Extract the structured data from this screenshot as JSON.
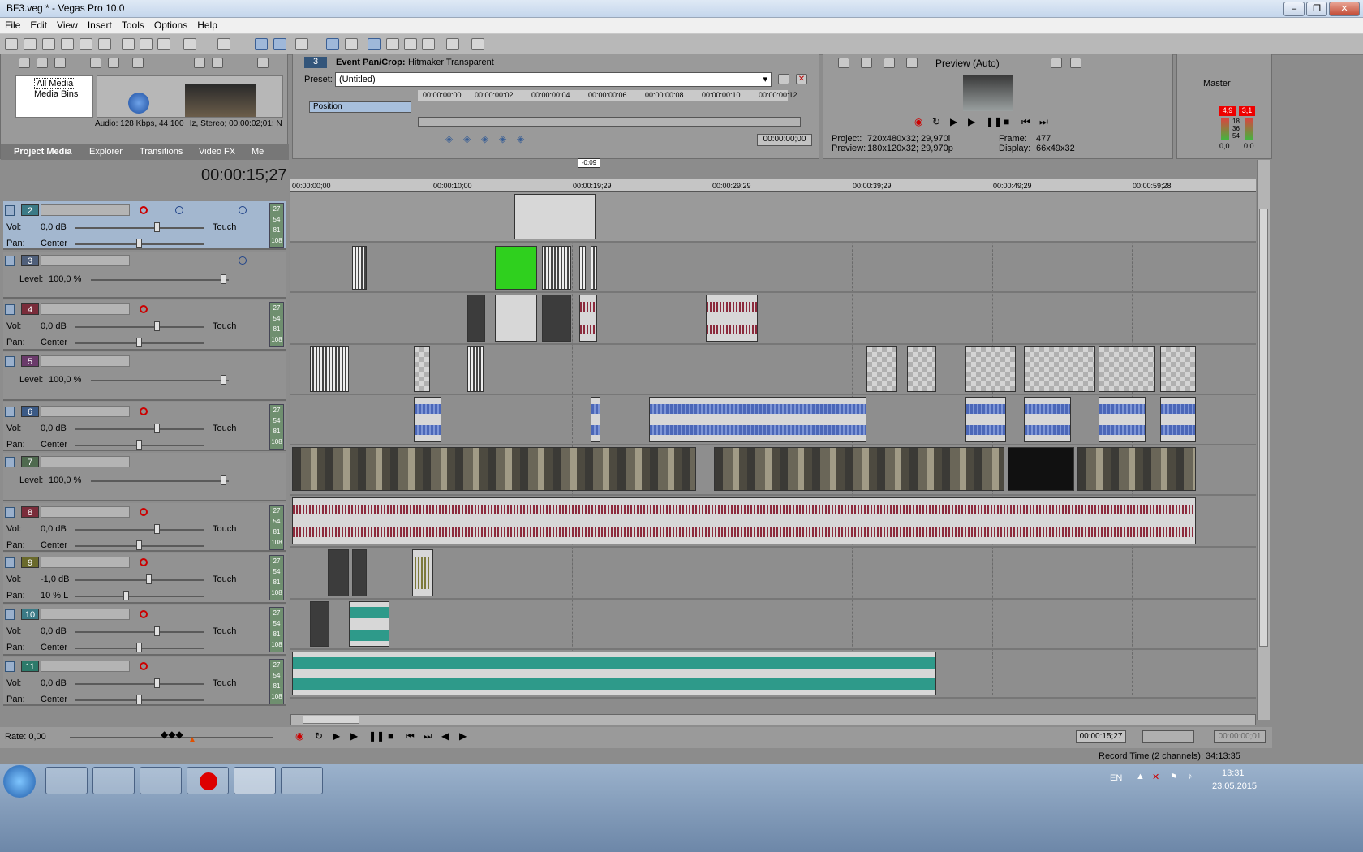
{
  "window": {
    "title": "BF3.veg * - Vegas Pro 10.0",
    "min": "‒",
    "max": "❐",
    "close": "✕"
  },
  "menu": [
    "File",
    "Edit",
    "View",
    "Insert",
    "Tools",
    "Options",
    "Help"
  ],
  "media": {
    "tree_all": "All Media",
    "tree_bins": "Media Bins",
    "audio_info": "Audio: 128 Kbps, 44 100 Hz, Stereo; 00:00:02;01; N",
    "tabs": [
      "Project Media",
      "Explorer",
      "Transitions",
      "Video FX",
      "Me"
    ]
  },
  "panzoom": {
    "track_num": "3",
    "title": "Event Pan/Crop:",
    "title_value": "Hitmaker Transparent",
    "preset_label": "Preset:",
    "preset_value": "(Untitled)",
    "position_label": "Position",
    "ruler": [
      "00:00:00:00",
      "00:00:00:02",
      "00:00:00:04",
      "00:00:00:06",
      "00:00:00:08",
      "00:00:00:10",
      "00:00:00:12"
    ],
    "time": "00:00:00;00"
  },
  "preview": {
    "mode": "Preview (Auto)",
    "project_label": "Project:",
    "project_value": "720x480x32; 29,970i",
    "preview_label": "Preview:",
    "preview_value": "180x120x32; 29,970p",
    "frame_label": "Frame:",
    "frame_value": "477",
    "display_label": "Display:",
    "display_value": "66x49x32"
  },
  "master": {
    "label": "Master",
    "left_peak": "4,9",
    "right_peak": "3,1",
    "scale": [
      "18",
      "36",
      "54"
    ],
    "left_val": "0,0",
    "right_val": "0,0"
  },
  "timecode": "00:00:15;27",
  "marker": "-0:09",
  "ruler": [
    "00:00:00;00",
    "00:00:10;00",
    "00:00:19;29",
    "00:00:29;29",
    "00:00:39;29",
    "00:00:49;29",
    "00:00:59;28"
  ],
  "tracks": [
    {
      "num": "2",
      "kind": "audio",
      "color": "#3b7a86",
      "vol": "0,0 dB",
      "pan": "Center",
      "sel": true
    },
    {
      "num": "3",
      "kind": "video",
      "color": "#4f5f7a",
      "level": "100,0 %"
    },
    {
      "num": "4",
      "kind": "audio",
      "color": "#7a2c3a",
      "vol": "0,0 dB",
      "pan": "Center"
    },
    {
      "num": "5",
      "kind": "video",
      "color": "#6a3a6a",
      "level": "100,0 %"
    },
    {
      "num": "6",
      "kind": "audio",
      "color": "#3b5a86",
      "vol": "0,0 dB",
      "pan": "Center"
    },
    {
      "num": "7",
      "kind": "video",
      "color": "#4f6a4f",
      "level": "100,0 %"
    },
    {
      "num": "8",
      "kind": "audio",
      "color": "#7a2c3a",
      "vol": "0,0 dB",
      "pan": "Center"
    },
    {
      "num": "9",
      "kind": "audio",
      "color": "#6a6a2c",
      "vol": "-1,0 dB",
      "pan": "10 % L"
    },
    {
      "num": "10",
      "kind": "audio",
      "color": "#3b7a86",
      "vol": "0,0 dB",
      "pan": "Center"
    },
    {
      "num": "11",
      "kind": "audio",
      "color": "#2c7a6a",
      "vol": "0,0 dB",
      "pan": "Center"
    }
  ],
  "labels": {
    "vol": "Vol:",
    "pan": "Pan:",
    "level": "Level:",
    "touch": "Touch",
    "meter": [
      "27",
      "54",
      "81",
      "108"
    ]
  },
  "rate": "Rate: 0,00",
  "bottom_time": "00:00:15;27",
  "bottom_time2": "00:00:00;01",
  "record_time": "Record Time (2 channels): 34:13:35",
  "tray": {
    "lang": "EN",
    "clock": "13:31",
    "date": "23.05.2015"
  }
}
